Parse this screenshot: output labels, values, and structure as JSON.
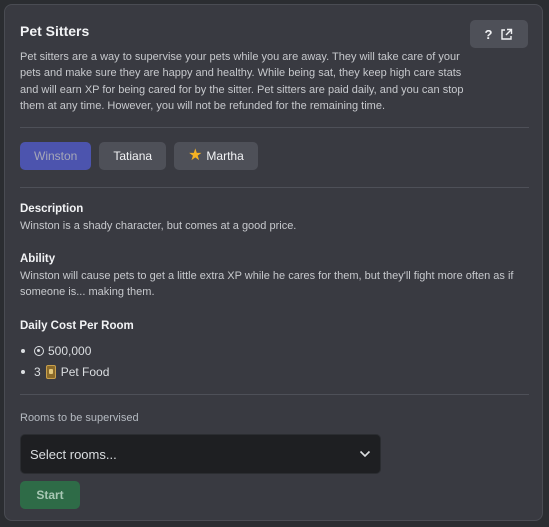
{
  "title": "Pet Sitters",
  "help_label": "?",
  "intro": "Pet sitters are a way to supervise your pets while you are away. They will take care of your pets and make sure they are happy and healthy. While being sat, they keep high care stats and will earn XP for being cared for by the sitter. Pet sitters are paid daily, and you can stop them at any time. However, you will not be refunded for the remaining time.",
  "tabs": [
    {
      "label": "Winston",
      "active": true
    },
    {
      "label": "Tatiana",
      "active": false
    },
    {
      "label": "Martha",
      "active": false,
      "icon": "star-icon"
    }
  ],
  "description": {
    "heading": "Description",
    "text": "Winston is a shady character, but comes at a good price."
  },
  "ability": {
    "heading": "Ability",
    "text": "Winston will cause pets to get a little extra XP while he cares for them, but they'll fight more often as if someone is... making them."
  },
  "cost": {
    "heading": "Daily Cost Per Room",
    "coins": "500,000",
    "food_qty": "3",
    "food_label": "Pet Food"
  },
  "rooms": {
    "label": "Rooms to be supervised",
    "placeholder": "Select rooms..."
  },
  "start_label": "Start",
  "colors": {
    "panel_bg": "#393a41",
    "accent": "#5865f2",
    "success": "#2e6b47"
  }
}
